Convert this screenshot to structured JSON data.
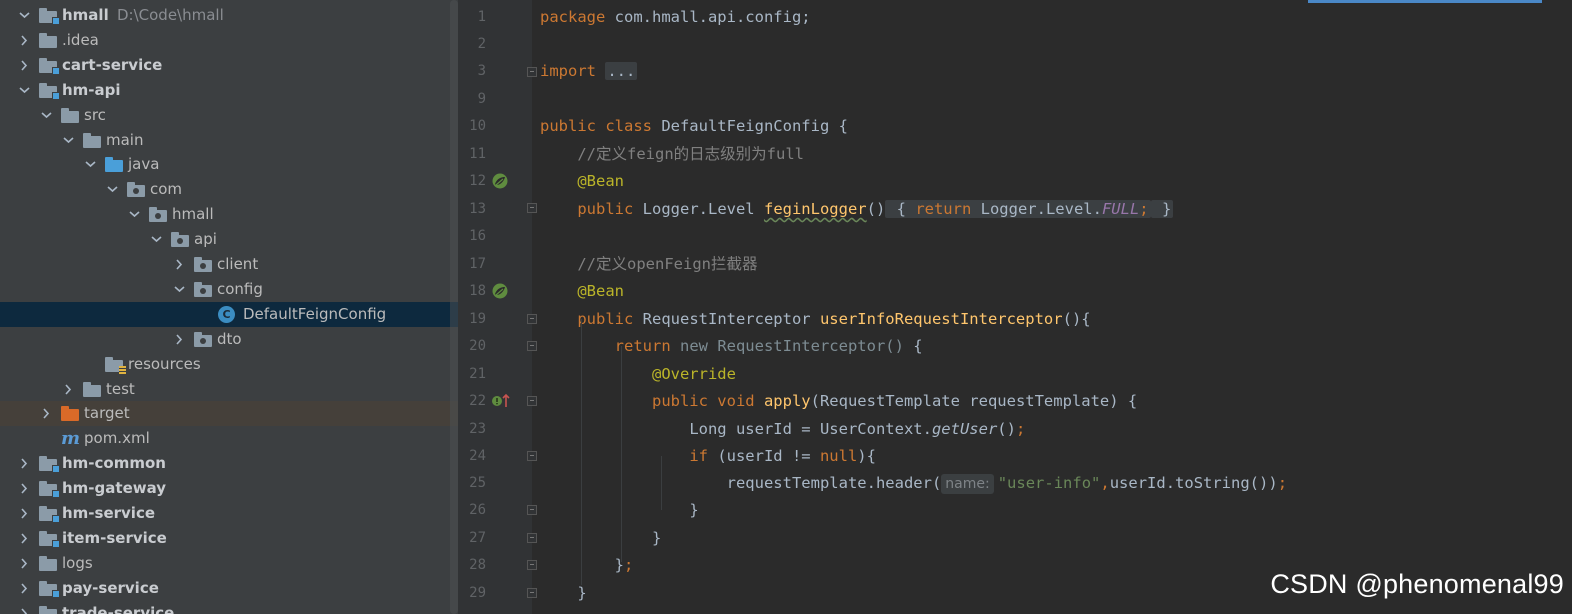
{
  "project_tree": {
    "rows": [
      {
        "label": "hmall",
        "hint": "D:\\Code\\hmall",
        "bold": true
      },
      {
        "label": ".idea"
      },
      {
        "label": "cart-service",
        "bold": true
      },
      {
        "label": "hm-api",
        "bold": true
      },
      {
        "label": "src"
      },
      {
        "label": "main"
      },
      {
        "label": "java"
      },
      {
        "label": "com"
      },
      {
        "label": "hmall"
      },
      {
        "label": "api"
      },
      {
        "label": "client"
      },
      {
        "label": "config"
      },
      {
        "label": "DefaultFeignConfig"
      },
      {
        "label": "dto"
      },
      {
        "label": "resources"
      },
      {
        "label": "test"
      },
      {
        "label": "target"
      },
      {
        "label": "pom.xml"
      },
      {
        "label": "hm-common",
        "bold": true
      },
      {
        "label": "hm-gateway",
        "bold": true
      },
      {
        "label": "hm-service",
        "bold": true
      },
      {
        "label": "item-service",
        "bold": true
      },
      {
        "label": "logs"
      },
      {
        "label": "pay-service",
        "bold": true
      },
      {
        "label": "trade-service",
        "bold": true
      }
    ],
    "icons": {
      "class_icon_letter": "C",
      "maven_icon_letter": "m"
    }
  },
  "editor": {
    "line_numbers": [
      "1",
      "2",
      "3",
      "9",
      "10",
      "11",
      "12",
      "13",
      "16",
      "17",
      "18",
      "19",
      "20",
      "21",
      "22",
      "23",
      "24",
      "25",
      "26",
      "27",
      "28",
      "29"
    ],
    "code": {
      "l1_kw": "package",
      "l1_rest": " com.hmall.api.config;",
      "l3_kw": "import",
      "l3_fold": "...",
      "l10_kw": "public class",
      "l10_rest": " DefaultFeignConfig {",
      "l11_cmt": "//定义feign的日志级别为full",
      "l12_ann": "@Bean",
      "l13_kw": "public",
      "l13_type": " Logger.Level ",
      "l13_fn": "feginLogger",
      "l13_paren": "()",
      "l13_fold_open": " {",
      "l13_return": " return",
      "l13_ref": " Logger.Level.",
      "l13_const": "FULL",
      "l13_semi": ";",
      "l13_fold_close": " }",
      "l17_cmt": "//定义openFeign拦截器",
      "l18_ann": "@Bean",
      "l19_kw": "public",
      "l19_type": " RequestInterceptor ",
      "l19_fn": "userInfoRequestInterceptor",
      "l19_rest": "(){",
      "l20_kw": "return",
      "l20_new": " new RequestInterceptor()",
      "l20_rest": " {",
      "l21_ann": "@Override",
      "l22_kw": "public void",
      "l22_fn": " apply",
      "l22_rest": "(RequestTemplate requestTemplate) {",
      "l23_type": "Long userId = UserContext.",
      "l23_call": "getUser",
      "l23_rest": "()",
      "l23_semi": ";",
      "l24_kw": "if",
      "l24_mid": " (userId != ",
      "l24_null": "null",
      "l24_rest": "){",
      "l25_pre": "requestTemplate.header(",
      "l25_hint": "name:",
      "l25_str": "\"user-info\"",
      "l25_comma": ",",
      "l25_rest": "userId.toString())",
      "l25_semi": ";",
      "l26": "}",
      "l27": "}",
      "l28_brace": "}",
      "l28_semi": ";",
      "l29": "}"
    }
  },
  "watermark": "CSDN @phenomenal99",
  "colors": {
    "keyword": "#cc7832",
    "annotation": "#bbb529",
    "function": "#ffc66d",
    "comment": "#808080",
    "string": "#6a8759",
    "constant": "#9876aa",
    "selection": "#0d293e"
  }
}
